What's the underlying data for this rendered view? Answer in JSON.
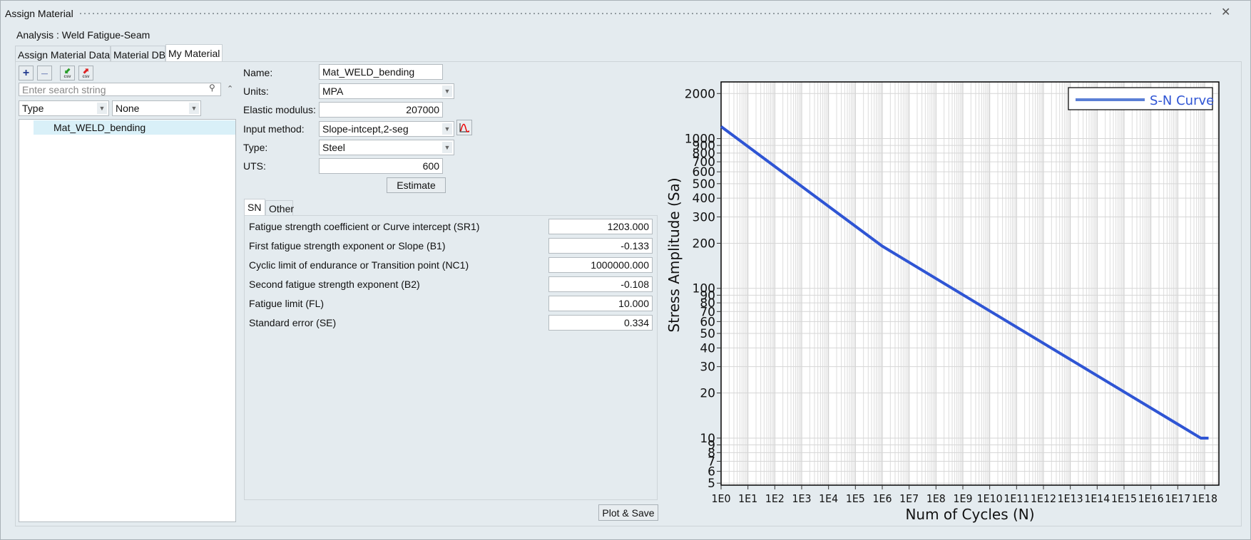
{
  "window": {
    "title": "Assign Material",
    "close_icon": "close-icon"
  },
  "analysis": "Analysis : Weld Fatigue-Seam",
  "tabs": [
    {
      "label": "Assign Material Data"
    },
    {
      "label": "Material DB"
    },
    {
      "label": "My Material",
      "active": true
    }
  ],
  "toolbar": {
    "add": "+",
    "remove": "—",
    "import_csv": "csv",
    "export_csv": "csv"
  },
  "search": {
    "placeholder": "Enter search string",
    "collapse": "⌃"
  },
  "filters": {
    "type": "Type",
    "value": "None"
  },
  "materials": [
    {
      "name": "Mat_WELD_bending",
      "selected": true
    }
  ],
  "form": {
    "name_label": "Name:",
    "name": "Mat_WELD_bending",
    "units_label": "Units:",
    "units": "MPA",
    "elastic_label": "Elastic modulus:",
    "elastic": "207000",
    "input_method_label": "Input method:",
    "input_method": "Slope-intcept,2-seg",
    "type_label": "Type:",
    "type": "Steel",
    "uts_label": "UTS:",
    "uts": "600",
    "estimate": "Estimate"
  },
  "subtabs": [
    {
      "label": "SN",
      "active": true
    },
    {
      "label": "Other"
    }
  ],
  "params": [
    {
      "label": "Fatigue strength coefficient or Curve intercept (SR1)",
      "value": "1203.000"
    },
    {
      "label": "First fatigue strength exponent or Slope (B1)",
      "value": "-0.133"
    },
    {
      "label": "Cyclic limit of endurance or Transition point (NC1)",
      "value": "1000000.000"
    },
    {
      "label": "Second fatigue strength exponent (B2)",
      "value": "-0.108"
    },
    {
      "label": "Fatigue limit (FL)",
      "value": "10.000"
    },
    {
      "label": "Standard error (SE)",
      "value": "0.334"
    }
  ],
  "plot_save": "Plot & Save",
  "chart_data": {
    "type": "line",
    "xscale": "log",
    "yscale": "log",
    "xlabel": "Num of Cycles (N)",
    "ylabel": "Stress Amplitude (Sa)",
    "xlim": [
      1,
      3.4e+18
    ],
    "ylim": [
      4.85,
      2390
    ],
    "xticks": [
      "1E0",
      "1E1",
      "1E2",
      "1E3",
      "1E4",
      "1E5",
      "1E6",
      "1E7",
      "1E8",
      "1E9",
      "1E10",
      "1E11",
      "1E12",
      "1E13",
      "1E14",
      "1E15",
      "1E16",
      "1E17",
      "1E18"
    ],
    "yticks": [
      5,
      6,
      7,
      8,
      9,
      10,
      20,
      30,
      40,
      50,
      60,
      70,
      80,
      90,
      100,
      200,
      300,
      400,
      500,
      600,
      700,
      800,
      900,
      1000,
      2000
    ],
    "grid": true,
    "legend": "top-right",
    "series": [
      {
        "name": "S-N Curve",
        "color": "#2f55d4",
        "points": [
          [
            1,
            1203
          ],
          [
            1000000,
            191.3
          ],
          [
            7.2e+17,
            10
          ],
          [
            1.4e+18,
            10
          ]
        ]
      }
    ]
  }
}
